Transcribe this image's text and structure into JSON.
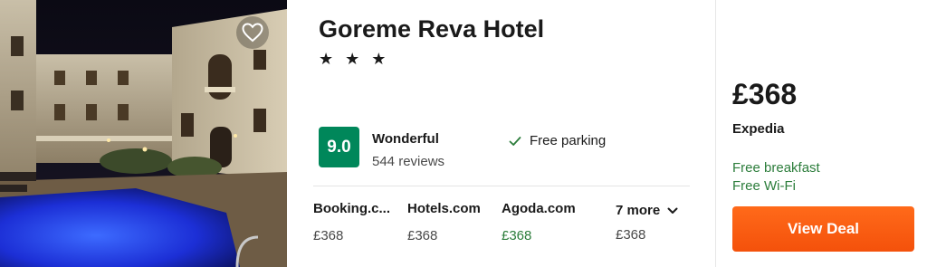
{
  "hotel": {
    "name": "Goreme Reva Hotel",
    "stars_display": "★ ★ ★",
    "star_count": 3,
    "favorite_icon": "heart-outline-icon"
  },
  "rating": {
    "score": "9.0",
    "label": "Wonderful",
    "reviews": "544 reviews",
    "color": "#00875a"
  },
  "amenities": [
    {
      "icon": "check-icon",
      "label": "Free parking"
    }
  ],
  "providers": [
    {
      "name": "Booking.c...",
      "price": "£368"
    },
    {
      "name": "Hotels.com",
      "price": "£368"
    },
    {
      "name": "Agoda.com",
      "price": "£368",
      "color": "#2c7d3b"
    }
  ],
  "more_providers": {
    "label": "7 more",
    "icon": "chevron-down-icon",
    "price": "£368"
  },
  "deal": {
    "price": "£368",
    "source": "Expedia",
    "perks": [
      "Free breakfast",
      "Free Wi-Fi"
    ],
    "perk_color": "#2c7d3b",
    "button_label": "View Deal",
    "button_color": "#f4510b"
  }
}
